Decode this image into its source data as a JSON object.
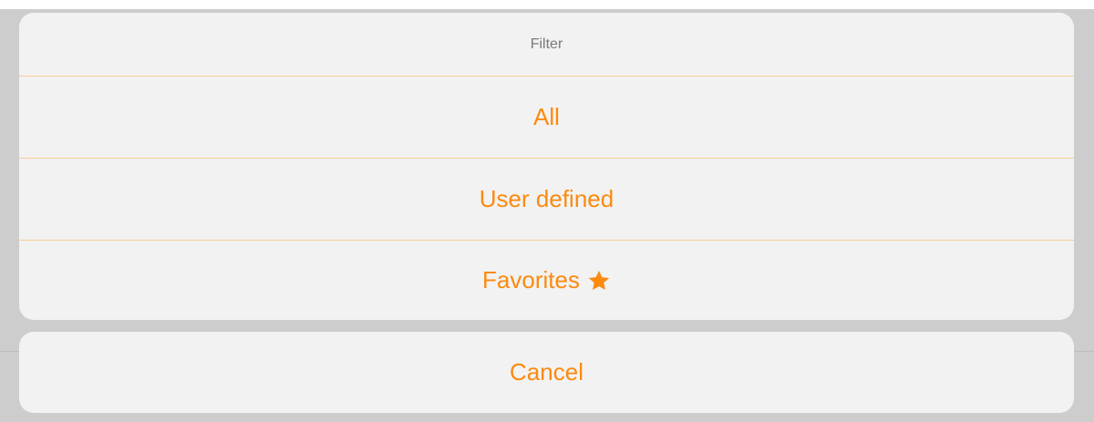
{
  "filter_sheet": {
    "title": "Filter",
    "options": [
      {
        "label": "All"
      },
      {
        "label": "User defined"
      },
      {
        "label": "Favorites",
        "icon": "star-icon"
      }
    ]
  },
  "cancel_sheet": {
    "label": "Cancel"
  },
  "colors": {
    "accent": "#fb8a0f",
    "divider": "#f5cf95",
    "sheet_background": "#f2f2f2",
    "title_text": "#7a7a7a"
  }
}
